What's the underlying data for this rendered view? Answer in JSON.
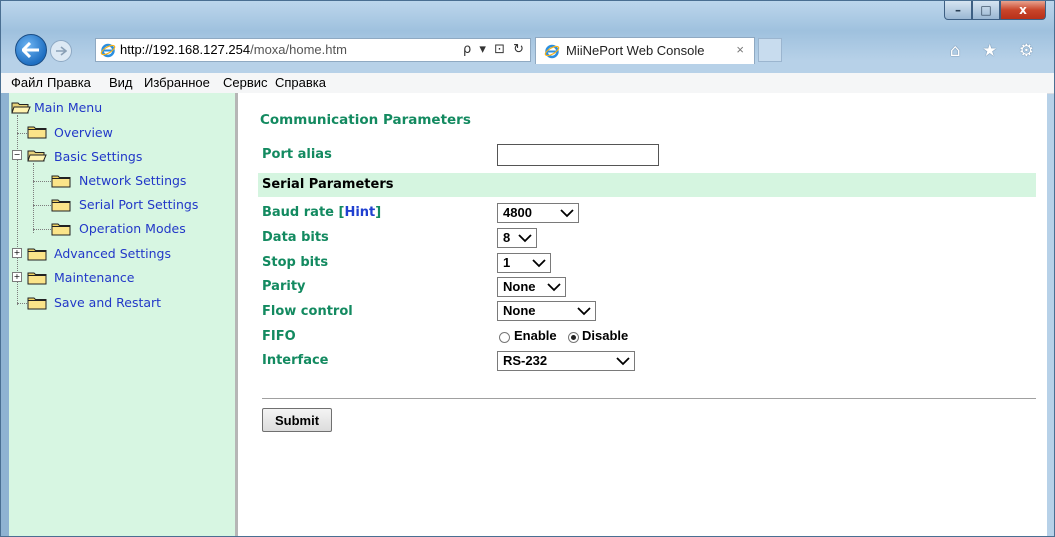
{
  "window": {
    "controls": {
      "minimize": "–",
      "maximize": "□",
      "close": "x"
    }
  },
  "browser": {
    "address": {
      "url_host": "http://192.168.127.254",
      "url_path": "/moxa/home.htm",
      "tools": "ρ ▾ ⊡ ↻"
    },
    "tab": {
      "title": "MiiNePort Web Console",
      "close": "×"
    },
    "right_icons": "⌂ ★ ⚙"
  },
  "menu": {
    "items": [
      {
        "label": "Файл"
      },
      {
        "label": "Правка"
      },
      {
        "label": "Вид"
      },
      {
        "label": "Избранное"
      },
      {
        "label": "Сервис"
      },
      {
        "label": "Справка"
      }
    ]
  },
  "sidebar": {
    "root": "Main Menu",
    "items": [
      {
        "label": "Overview"
      },
      {
        "label": "Basic Settings"
      },
      {
        "label": "Network Settings"
      },
      {
        "label": "Serial Port Settings"
      },
      {
        "label": "Operation Modes"
      },
      {
        "label": "Advanced Settings"
      },
      {
        "label": "Maintenance"
      },
      {
        "label": "Save and Restart"
      }
    ]
  },
  "main": {
    "title": "Communication Parameters",
    "port_alias_label": "Port alias",
    "port_alias_value": "",
    "section_title": "Serial Parameters",
    "fields": {
      "baud_rate": {
        "label": "Baud rate [",
        "hint": "Hint",
        "label_end": "]",
        "value": "4800"
      },
      "data_bits": {
        "label": "Data bits",
        "value": "8"
      },
      "stop_bits": {
        "label": "Stop bits",
        "value": "1"
      },
      "parity": {
        "label": "Parity",
        "value": "None"
      },
      "flow_control": {
        "label": "Flow control",
        "value": "None"
      },
      "fifo": {
        "label": "FIFO",
        "enable": "Enable",
        "disable": "Disable",
        "selected": "Disable"
      },
      "interface": {
        "label": "Interface",
        "value": "RS-232"
      }
    },
    "submit_label": "Submit"
  },
  "colors": {
    "label_green": "#138a60",
    "sidebar_bg": "#d7f6e2",
    "section_bg": "#d5f5e0",
    "link_blue": "#2238c8"
  }
}
